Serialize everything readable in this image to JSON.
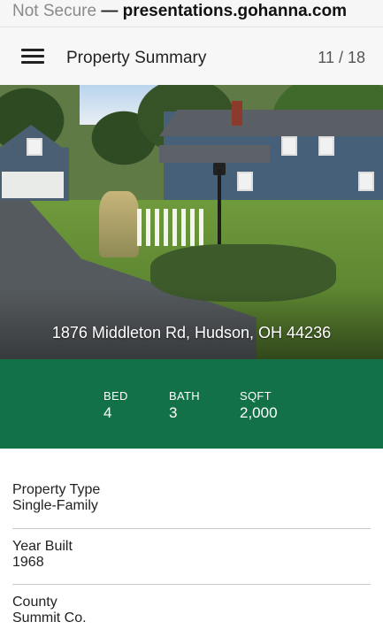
{
  "browser": {
    "security_label": "Not Secure",
    "separator": "—",
    "host": "presentations.gohanna.com"
  },
  "header": {
    "title": "Property Summary",
    "counter": "11 / 18"
  },
  "hero": {
    "address": "1876 Middleton Rd, Hudson, OH 44236"
  },
  "stats": [
    {
      "label": "BED",
      "value": "4"
    },
    {
      "label": "BATH",
      "value": "3"
    },
    {
      "label": "SQFT",
      "value": "2,000"
    }
  ],
  "details": [
    {
      "label": "Property Type",
      "value": "Single-Family"
    },
    {
      "label": "Year Built",
      "value": "1968"
    },
    {
      "label": "County",
      "value": "Summit Co."
    }
  ],
  "colors": {
    "accent": "#127146"
  }
}
